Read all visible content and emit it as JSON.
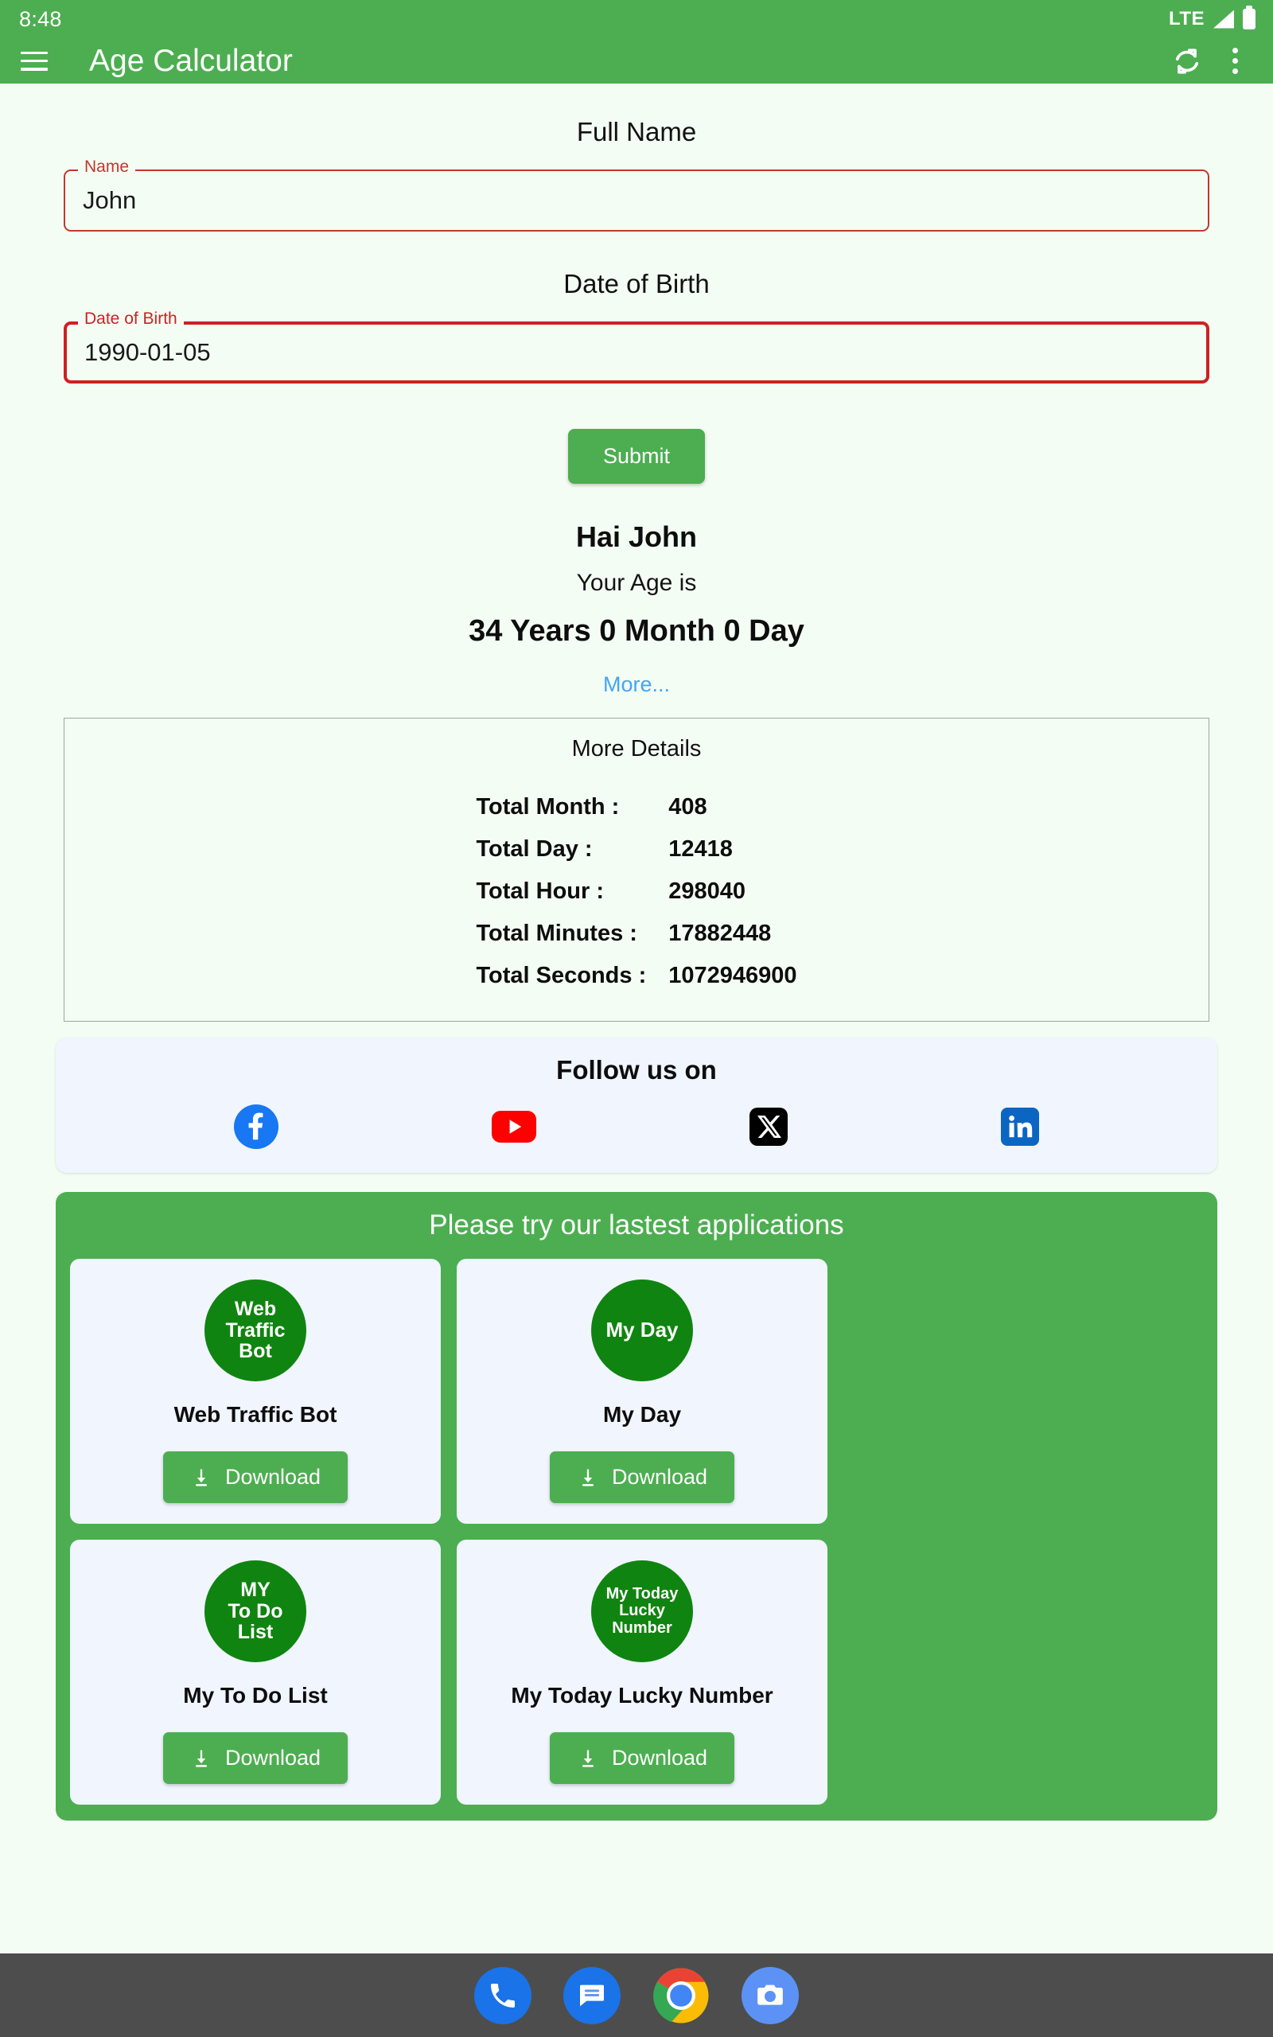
{
  "status_bar": {
    "time": "8:48",
    "network": "LTE",
    "signal_icon": "signal-bars-icon",
    "battery_icon": "battery-full-icon"
  },
  "app_bar": {
    "menu_icon": "hamburger-menu-icon",
    "title": "Age Calculator",
    "refresh_icon": "sync-refresh-icon",
    "overflow_icon": "overflow-menu-icon",
    "background_color": "#4CAE50"
  },
  "form": {
    "name_heading": "Full Name",
    "name_label": "Name",
    "name_value": "John",
    "name_placeholder": "Name",
    "dob_heading": "Date of Birth",
    "dob_label": "Date of Birth",
    "dob_value": "1990-01-05",
    "dob_placeholder": "Date of Birth",
    "submit_label": "Submit",
    "field_border_color": "#C0392B"
  },
  "result": {
    "greeting": "Hai John",
    "subtitle": "Your Age is",
    "age": "34 Years 0 Month 0 Day",
    "more_link": "More...",
    "more_link_color": "#42A5F5"
  },
  "more_details": {
    "title": "More Details",
    "rows": [
      {
        "key": "Total Month :",
        "value": "408"
      },
      {
        "key": "Total Day :",
        "value": "12418"
      },
      {
        "key": "Total Hour :",
        "value": "298040"
      },
      {
        "key": "Total Minutes :",
        "value": "17882448"
      },
      {
        "key": "Total Seconds :",
        "value": "1072946900"
      }
    ]
  },
  "follow": {
    "title": "Follow us on",
    "items": [
      {
        "name": "facebook-icon",
        "color": "#1877F2"
      },
      {
        "name": "youtube-icon",
        "color": "#FF0000"
      },
      {
        "name": "x-twitter-icon",
        "color": "#000000"
      },
      {
        "name": "linkedin-icon",
        "color": "#0A66C2"
      }
    ]
  },
  "apps_section": {
    "title": "Please try our lastest applications",
    "download_label": "Download",
    "cards": [
      {
        "logo_lines": [
          "Web",
          "Traffic",
          "Bot"
        ],
        "name": "Web Traffic Bot",
        "logo_size": "sz-3"
      },
      {
        "logo_lines": [
          "My Day"
        ],
        "name": "My Day",
        "logo_size": "sz-1"
      },
      {
        "logo_lines": [
          "MY",
          "To Do",
          "List"
        ],
        "name": "My To Do List",
        "logo_size": "sz-3"
      },
      {
        "logo_lines": [
          "My Today",
          "Lucky",
          "Number"
        ],
        "name": "My Today Lucky Number",
        "logo_size": "sz-small"
      }
    ]
  },
  "dock": {
    "items": [
      {
        "name": "phone-icon"
      },
      {
        "name": "messages-icon"
      },
      {
        "name": "chrome-icon"
      },
      {
        "name": "camera-icon"
      }
    ]
  }
}
